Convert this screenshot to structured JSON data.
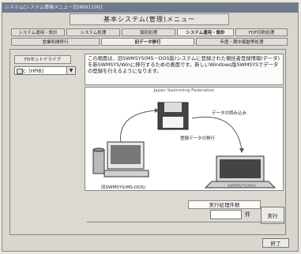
{
  "window": {
    "title": "システム[システム情報メニュー][SMW1100]"
  },
  "header": {
    "title": "基本システム(管理)メニュー"
  },
  "tabs_row1": [
    "システム運用・設計",
    "システム処理",
    "個別処理",
    "システム運用・設計",
    "FDF印刷処理"
  ],
  "tabs_row2": [
    "営業所間移行",
    "旧データ移行",
    "年度・期中異動等処理"
  ],
  "fd": {
    "label": "FDセットドライブ",
    "drive": "c: [HPIB]"
  },
  "description": "この画面は、旧SWMSYS(MS－DOS版)システムに登録された競技者登録情報(データ)を新SWMSYS/Winに移行するための画面です。新しいWindows版SWMSYSでデータの登録を行えるようになります。",
  "diagram": {
    "title": "Japan Swimming Federation",
    "label_migrate": "登録データの移行",
    "label_fd_read": "データの読み込み",
    "label_old": "旧SWMSYS(MS-DOS)",
    "label_new": "SWMSYS/Win"
  },
  "count": {
    "label": "実行処理件数",
    "unit": "件"
  },
  "buttons": {
    "execute": "実行",
    "end": "終了"
  },
  "colors": {
    "titlebar": "#6f7a8f",
    "background": "#d9d6cf"
  }
}
